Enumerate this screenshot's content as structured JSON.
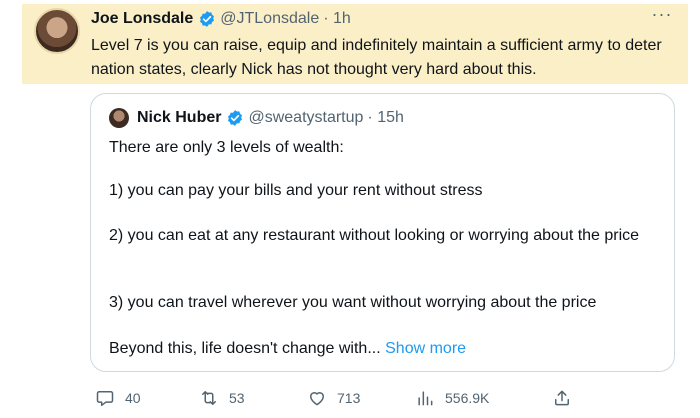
{
  "tweet": {
    "author_name": "Joe Lonsdale",
    "author_handle": "@JTLonsdale",
    "time": "· 1h",
    "more_label": "···",
    "text": "Level 7 is you can raise, equip and indefinitely maintain a sufficient army to deter nation states, clearly Nick has not thought very hard about this."
  },
  "quoted": {
    "author_name": "Nick Huber",
    "author_handle": "@sweatystartup",
    "time": "· 15h",
    "lines": [
      "There are only 3 levels of wealth:",
      "1) you can pay your bills and your rent without stress",
      "2) you can eat at any restaurant without looking or worrying about the price",
      "3) you can travel wherever you want without worrying about the price",
      "Beyond this, life doesn't change with..."
    ],
    "show_more": "Show more"
  },
  "actions": {
    "replies": "40",
    "retweets": "53",
    "likes": "713",
    "views": "556.9K"
  },
  "colors": {
    "highlight": "#fbefc8",
    "link": "#1d9bf0",
    "verified": "#1d9bf0",
    "muted": "#536471"
  }
}
